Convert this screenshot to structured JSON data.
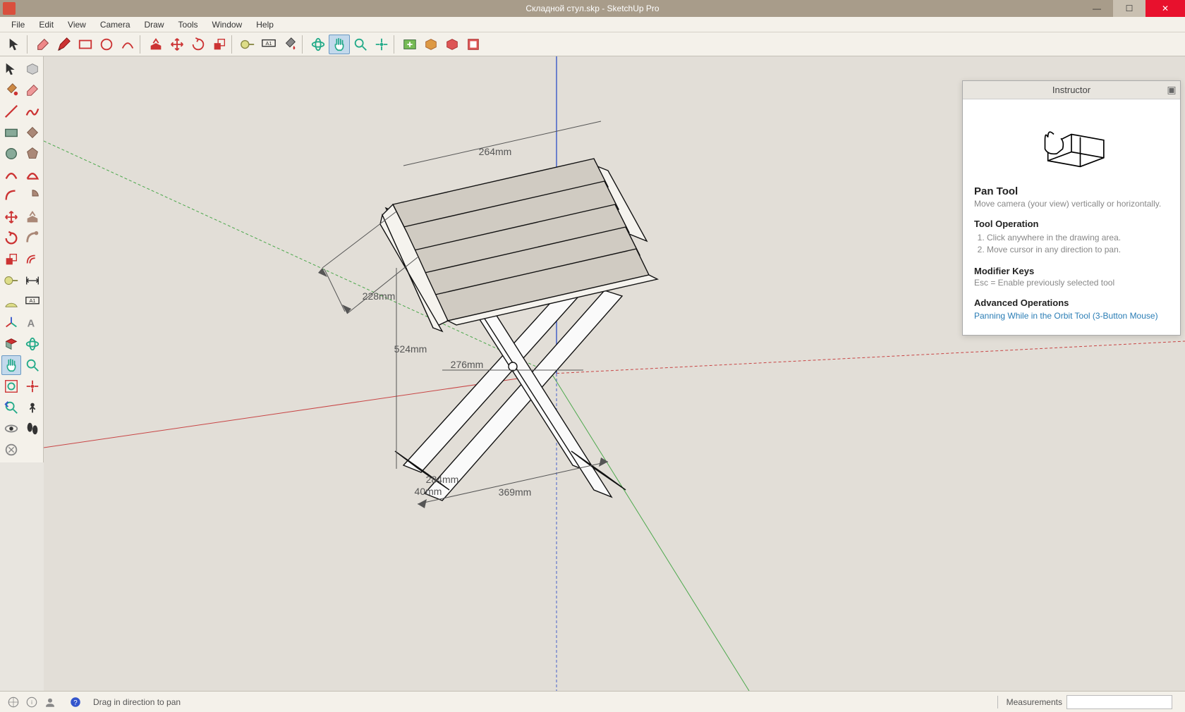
{
  "titlebar": {
    "text": "Складной стул.skp - SketchUp Pro"
  },
  "menu": [
    "File",
    "Edit",
    "View",
    "Camera",
    "Draw",
    "Tools",
    "Window",
    "Help"
  ],
  "statusbar": {
    "hint": "Drag in direction to pan",
    "measurements_label": "Measurements",
    "measurements_value": ""
  },
  "instructor": {
    "title": "Instructor",
    "heading": "Pan Tool",
    "subtitle": "Move camera (your view) vertically or horizontally.",
    "op_heading": "Tool Operation",
    "steps": [
      "Click anywhere in the drawing area.",
      "Move cursor in any direction to pan."
    ],
    "mod_heading": "Modifier Keys",
    "mod_text": "Esc = Enable previously selected tool",
    "adv_heading": "Advanced Operations",
    "adv_link": "Panning While in the Orbit Tool (3-Button Mouse)"
  },
  "dimensions": {
    "top": "264mm",
    "diag": "228mm",
    "height": "524mm",
    "mid": "276mm",
    "bottom_depth": "284mm",
    "bottom_thick": "40mm",
    "bottom_width": "369mm"
  },
  "top_toolbar_icons": [
    "select-arrow",
    "eraser",
    "pencil",
    "rectangle",
    "circle",
    "arc",
    "push-pull",
    "move",
    "rotate",
    "scale",
    "offset",
    "tape-measure",
    "text",
    "paint-bucket",
    "orbit",
    "pan",
    "zoom",
    "zoom-extents",
    "section",
    "layers",
    "shadows",
    "guide"
  ],
  "left_toolbar_icons": [
    "select",
    "component",
    "line",
    "freehand",
    "rectangle",
    "pencil",
    "circle",
    "polygon",
    "arc",
    "pie",
    "push-pull",
    "offset",
    "move",
    "rotate",
    "scale-red",
    "scale-green",
    "tape",
    "protractor",
    "dimension",
    "text",
    "axes",
    "planes",
    "orbit",
    "pan",
    "zoom",
    "zoom-window",
    "zoom-extents",
    "walk",
    "position",
    "look"
  ]
}
